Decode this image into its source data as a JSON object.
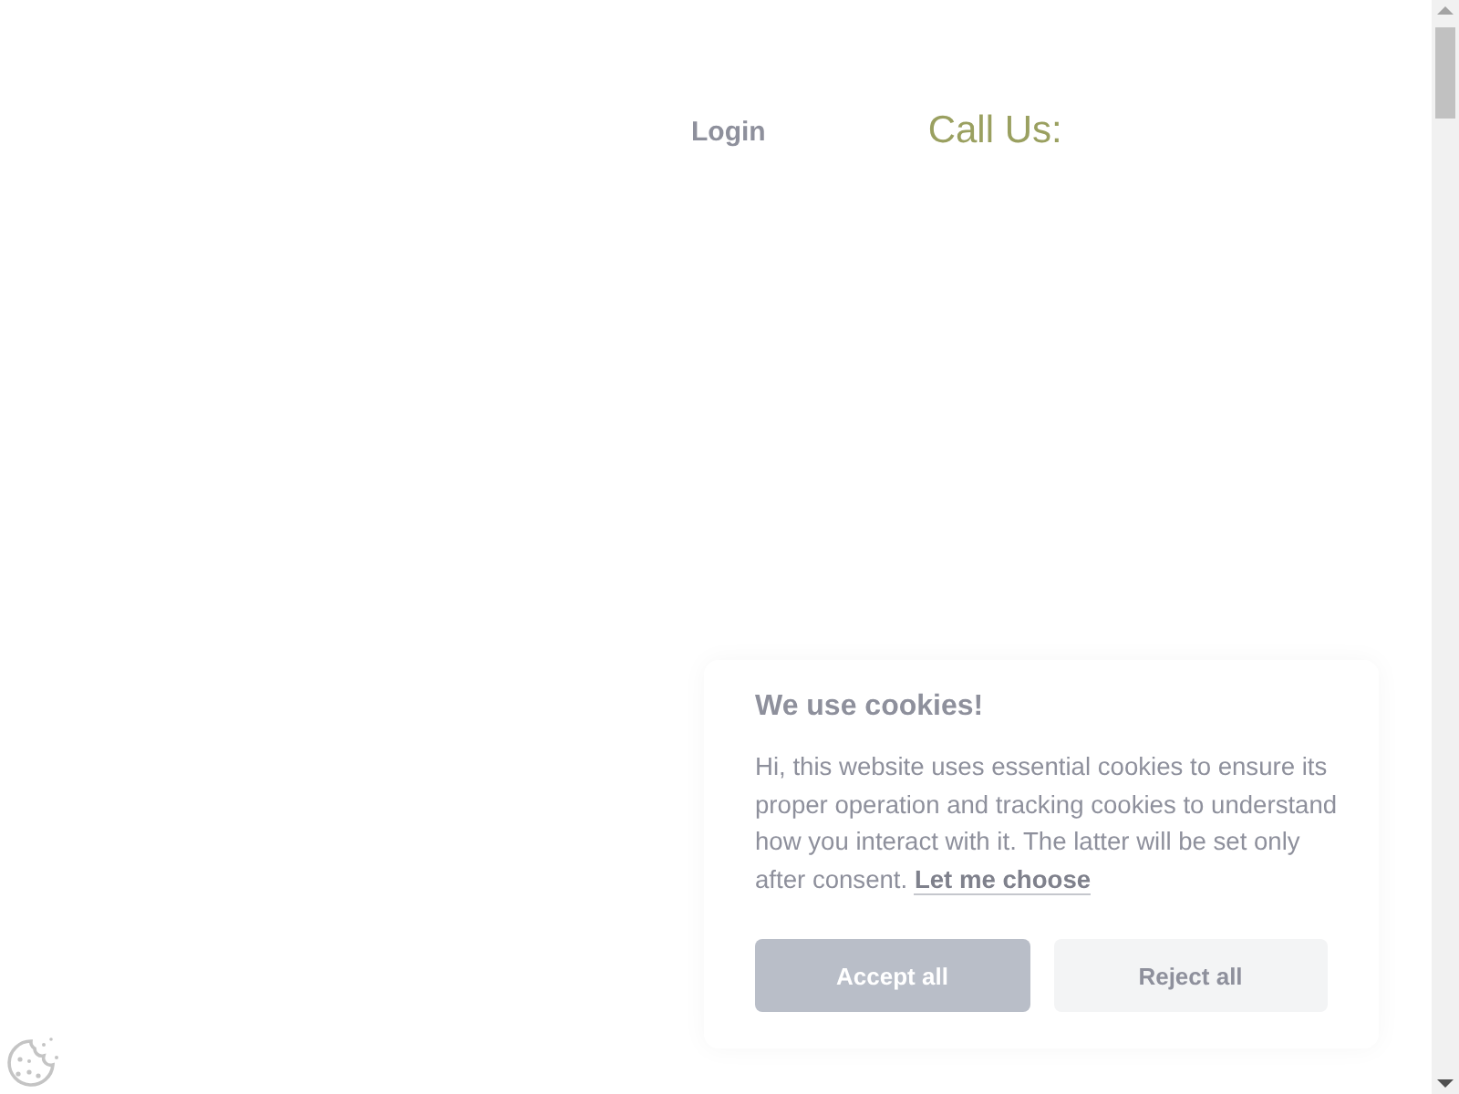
{
  "header": {
    "login": "Login",
    "call_us": "Call Us:"
  },
  "cookie_banner": {
    "title": "We use cookies!",
    "text": "Hi, this website uses essential cookies to ensure its proper operation and tracking cookies to understand how you interact with it. The latter will be set only after consent.",
    "link": "Let me choose",
    "buttons": [
      {
        "label": "Accept all",
        "kind": "primary"
      },
      {
        "label": "Reject all",
        "kind": "secondary"
      }
    ]
  }
}
